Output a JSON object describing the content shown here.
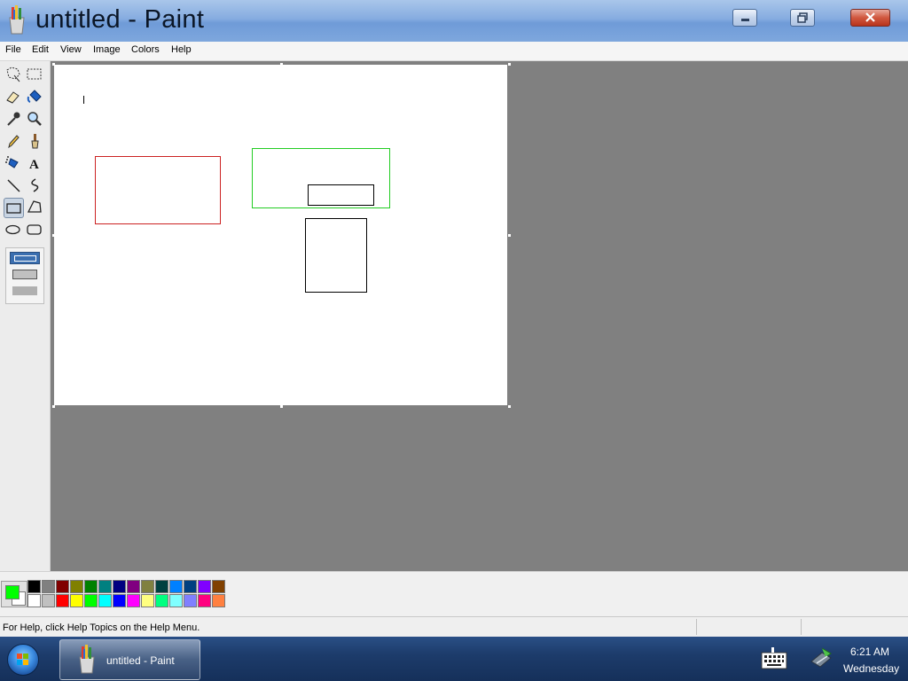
{
  "window": {
    "title": "untitled - Paint"
  },
  "menu": {
    "items": [
      "File",
      "Edit",
      "View",
      "Image",
      "Colors",
      "Help"
    ]
  },
  "tools": [
    {
      "name": "free-form-select-icon"
    },
    {
      "name": "select-icon"
    },
    {
      "name": "eraser-icon"
    },
    {
      "name": "fill-with-color-icon"
    },
    {
      "name": "pick-color-icon"
    },
    {
      "name": "magnifier-icon"
    },
    {
      "name": "pencil-icon"
    },
    {
      "name": "brush-icon"
    },
    {
      "name": "airbrush-icon"
    },
    {
      "name": "text-icon",
      "glyph": "A"
    },
    {
      "name": "line-icon"
    },
    {
      "name": "curve-icon"
    },
    {
      "name": "rectangle-icon",
      "selected": true
    },
    {
      "name": "polygon-icon"
    },
    {
      "name": "ellipse-icon"
    },
    {
      "name": "rounded-rectangle-icon"
    }
  ],
  "palette": {
    "foreground": "#00ff00",
    "background": "#ffffff",
    "row1": [
      "#000000",
      "#808080",
      "#800000",
      "#808000",
      "#008000",
      "#008080",
      "#000080",
      "#800080",
      "#808040",
      "#004040",
      "#0080ff",
      "#004080",
      "#8000ff",
      "#804000"
    ],
    "row2": [
      "#ffffff",
      "#c0c0c0",
      "#ff0000",
      "#ffff00",
      "#00ff00",
      "#00ffff",
      "#0000ff",
      "#ff00ff",
      "#ffff80",
      "#00ff80",
      "#80ffff",
      "#8080ff",
      "#ff0080",
      "#ff8040"
    ]
  },
  "status": {
    "text": "For Help, click Help Topics on the Help Menu."
  },
  "taskbar": {
    "task_label": "untitled - Paint",
    "time": "6:21 AM",
    "day": "Wednesday"
  },
  "colors": {
    "red_rect": "#cc2222",
    "green_rect": "#22cc22",
    "black_rect": "#000000",
    "workspace": "#808080"
  }
}
